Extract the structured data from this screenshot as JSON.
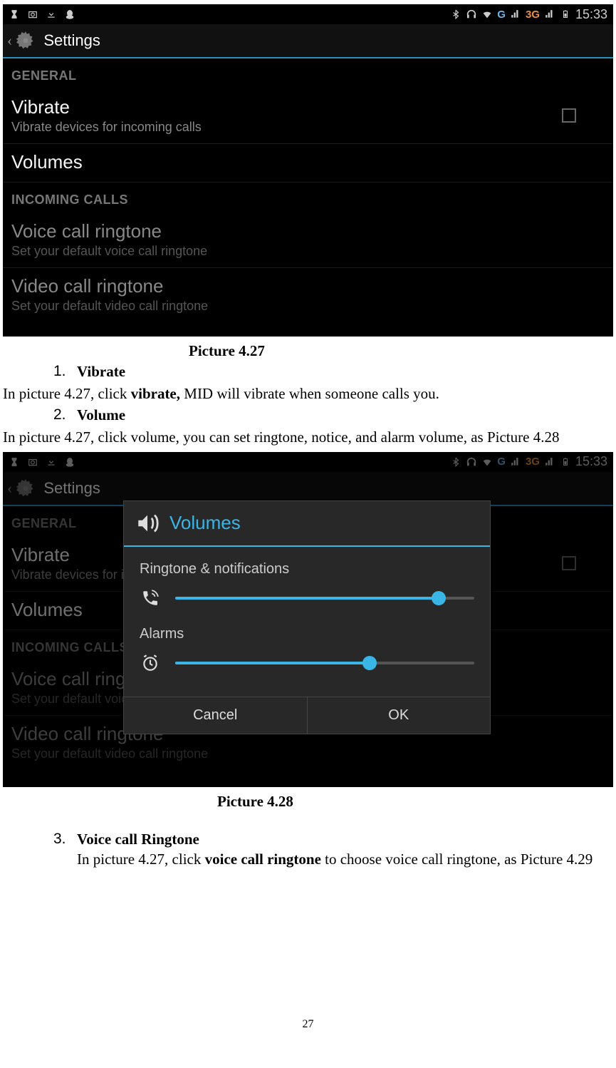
{
  "statusbar": {
    "time": "15:33",
    "network3g": "3G",
    "g_label": "G"
  },
  "screenshot1": {
    "header": "Settings",
    "section_general": "GENERAL",
    "vibrate": {
      "title": "Vibrate",
      "sub": "Vibrate devices for incoming calls"
    },
    "volumes": {
      "title": "Volumes"
    },
    "section_incoming": "INCOMING CALLS",
    "voice": {
      "title": "Voice call ringtone",
      "sub": "Set your default voice call ringtone"
    },
    "video": {
      "title": "Video call ringtone",
      "sub": "Set your default video call ringtone"
    }
  },
  "caption1": "Picture 4.27",
  "item1": {
    "num": "1.",
    "label": "Vibrate"
  },
  "text1a": "In picture 4.27, click ",
  "text1b": "vibrate,",
  "text1c": " MID will vibrate when someone calls you.",
  "item2": {
    "num": "2.",
    "label": "Volume"
  },
  "text2": "In picture 4.27, click volume, you can set ringtone, notice, and alarm volume, as Picture 4.28",
  "dialog": {
    "title": "Volumes",
    "label_ringtone": "Ringtone & notifications",
    "label_alarms": "Alarms",
    "cancel": "Cancel",
    "ok": "OK",
    "slider1_pct": 88,
    "slider2_pct": 65
  },
  "caption2": "Picture 4.28",
  "item3": {
    "num": "3.",
    "label": "Voice call Ringtone"
  },
  "text3a": "In picture 4.27, click ",
  "text3b": "voice call ringtone",
  "text3c": " to choose voice call ringtone, as Picture 4.29",
  "page_number": "27"
}
